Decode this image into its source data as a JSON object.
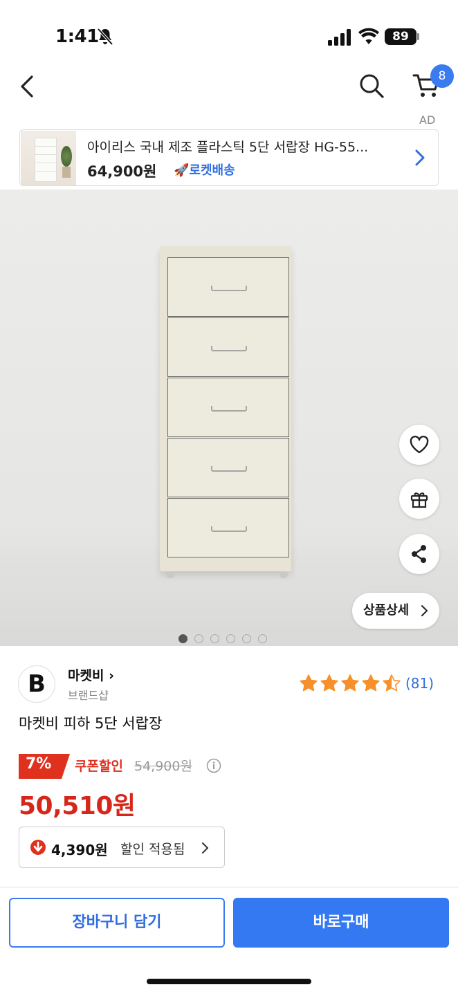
{
  "status_bar": {
    "time": "1:41",
    "battery": "89"
  },
  "nav": {
    "cart_count": "8"
  },
  "ad": {
    "tag": "AD",
    "title": "아이리스 국내 제조 플라스틱 5단 서랍장 HG-55...",
    "price": "64,900원",
    "delivery": "로켓배송"
  },
  "gallery": {
    "detail_label": "상품상세",
    "image_count": 6,
    "active_index": 0
  },
  "brand": {
    "logo_letter": "B",
    "name": "마켓비",
    "subtitle": "브랜드샵"
  },
  "rating": {
    "stars": 4.5,
    "review_count": "(81)"
  },
  "product": {
    "title": "마켓비 피하 5단 서랍장",
    "discount_percent": "7%",
    "coupon_label": "쿠폰할인",
    "original_price": "54,900원",
    "sale_price": "50,510원",
    "saving_amount": "4,390원",
    "saving_text": "할인 적용됨"
  },
  "actions": {
    "add_to_cart": "장바구니 담기",
    "buy_now": "바로구매"
  },
  "colors": {
    "accent_blue": "#3479f2",
    "sale_red": "#d7261a",
    "star_orange": "#f7902a"
  }
}
